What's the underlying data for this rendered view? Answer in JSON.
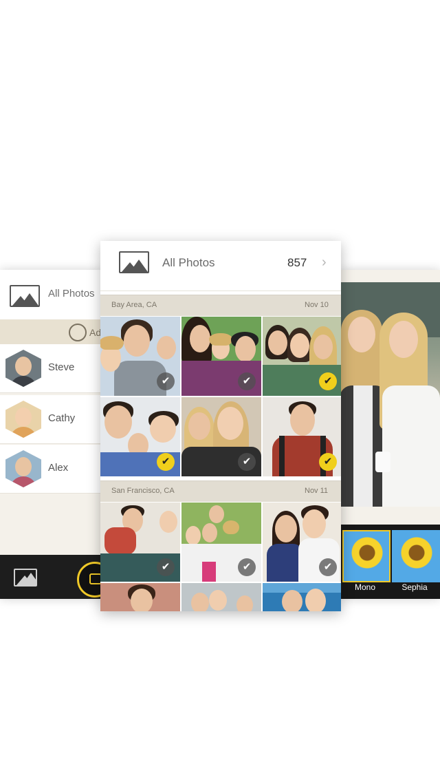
{
  "left_panel": {
    "header_title": "All Photos",
    "add_label": "Ad",
    "contacts": [
      {
        "name": "Steve"
      },
      {
        "name": "Cathy"
      },
      {
        "name": "Alex"
      }
    ],
    "tabbar": {
      "photos_icon": "image-icon",
      "camera_icon": "camera-icon"
    }
  },
  "main": {
    "header": {
      "title": "All Photos",
      "count": "857",
      "chevron": "›"
    },
    "sections": [
      {
        "place": "Bay Area, CA",
        "date": "Nov 10",
        "photos": [
          {
            "selected": false
          },
          {
            "selected": false
          },
          {
            "selected": true
          },
          {
            "selected": false
          },
          {
            "selected": false
          },
          {
            "selected": true
          }
        ]
      },
      {
        "place": "San Francisco, CA",
        "date": "Nov 11",
        "photos": [
          {
            "selected": false
          },
          {
            "selected": false
          },
          {
            "selected": false
          }
        ]
      }
    ],
    "check_glyph": "✔"
  },
  "right_panel": {
    "filters": [
      {
        "label": "Mono",
        "selected": true
      },
      {
        "label": "Sephia",
        "selected": false
      }
    ]
  },
  "colors": {
    "accent": "#f0c928",
    "section_bg": "#e2ddd2",
    "tabbar_bg": "#1d1d1d"
  }
}
